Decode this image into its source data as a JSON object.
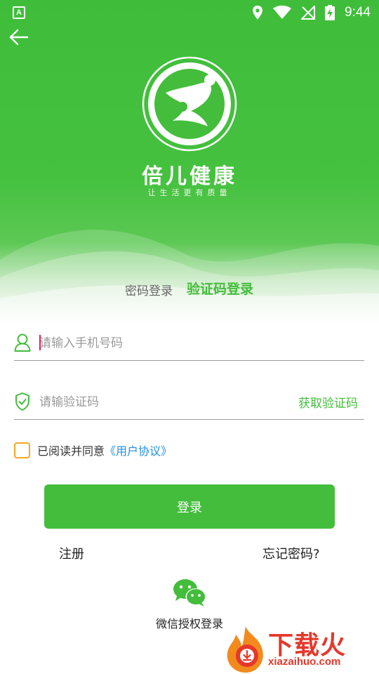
{
  "status_bar": {
    "app_icon_letter": "A",
    "time": "9:44"
  },
  "brand": {
    "name": "倍儿健康",
    "slogan": "让生活更有质量"
  },
  "tabs": {
    "password_login": "密码登录",
    "sms_login": "验证码登录"
  },
  "form": {
    "phone_placeholder": "请输入手机号码",
    "code_placeholder": "请输验证码",
    "get_code": "获取验证码",
    "agree_text": "已阅读并同意",
    "agreement_link": "《用户协议》"
  },
  "actions": {
    "login": "登录",
    "register": "注册",
    "forgot_password": "忘记密码?",
    "wechat_login": "微信授权登录"
  },
  "watermark": {
    "cn": "下载火",
    "en": "xiazaihuo.com"
  },
  "colors": {
    "brand_green": "#43bd3b",
    "checkbox_orange": "#f5a623",
    "link_blue": "#1f8ee8",
    "watermark_red": "#e5382b"
  }
}
